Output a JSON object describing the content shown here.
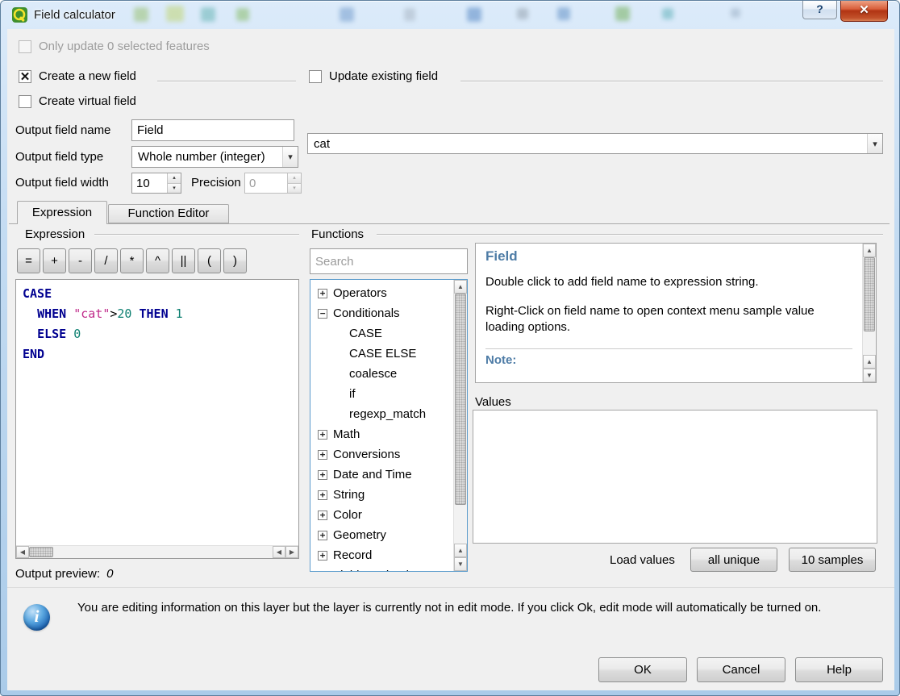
{
  "colors": {
    "keyword": "#000090",
    "field": "#c02a8a",
    "number": "#0c7f70",
    "help_heading": "#4e7ca6"
  },
  "icons": {
    "help": "?",
    "close": "✕",
    "check": "✕",
    "dropdown": "▾",
    "spin_up": "▴",
    "spin_down": "▾",
    "scroll_up": "▲",
    "scroll_down": "▼",
    "scroll_left": "◀",
    "scroll_right": "▶",
    "info": "i"
  },
  "window": {
    "title": "Field calculator"
  },
  "header": {
    "only_update_label": "Only update 0 selected features",
    "create_new_field_label": "Create a new field",
    "update_existing_label": "Update existing field",
    "create_virtual_label": "Create virtual field",
    "output_field_name_label": "Output field name",
    "output_field_name_value": "Field",
    "output_field_type_label": "Output field type",
    "output_field_type_value": "Whole number (integer)",
    "output_field_width_label": "Output field width",
    "output_field_width_value": "10",
    "precision_label": "Precision",
    "precision_value": "0",
    "existing_field_value": "cat"
  },
  "tabs": [
    {
      "label": "Expression"
    },
    {
      "label": "Function Editor"
    }
  ],
  "expression": {
    "group_label": "Expression",
    "operators": [
      "=",
      "+",
      "-",
      "/",
      "*",
      "^",
      "||",
      "(",
      ")"
    ],
    "code_lines": [
      [
        {
          "t": "CASE",
          "c": "kw"
        }
      ],
      [
        {
          "t": "  ",
          "c": "pl"
        },
        {
          "t": "WHEN",
          "c": "kw"
        },
        {
          "t": " ",
          "c": "pl"
        },
        {
          "t": "\"cat\"",
          "c": "str"
        },
        {
          "t": ">",
          "c": "pl"
        },
        {
          "t": "20",
          "c": "num"
        },
        {
          "t": " ",
          "c": "pl"
        },
        {
          "t": "THEN",
          "c": "kw"
        },
        {
          "t": " ",
          "c": "pl"
        },
        {
          "t": "1",
          "c": "num"
        }
      ],
      [
        {
          "t": "  ",
          "c": "pl"
        },
        {
          "t": "ELSE",
          "c": "kw"
        },
        {
          "t": " ",
          "c": "pl"
        },
        {
          "t": "0",
          "c": "num"
        }
      ],
      [
        {
          "t": "END",
          "c": "kw"
        }
      ]
    ],
    "output_preview_label": "Output preview:",
    "output_preview_value": "0"
  },
  "functions": {
    "group_label": "Functions",
    "search_placeholder": "Search",
    "tree": [
      {
        "label": "Operators",
        "expander": "+",
        "indent": 0
      },
      {
        "label": "Conditionals",
        "expander": "−",
        "indent": 0
      },
      {
        "label": "CASE",
        "indent": 1
      },
      {
        "label": "CASE ELSE",
        "indent": 1
      },
      {
        "label": "coalesce",
        "indent": 1
      },
      {
        "label": "if",
        "indent": 1
      },
      {
        "label": "regexp_match",
        "indent": 1
      },
      {
        "label": "Math",
        "expander": "+",
        "indent": 0
      },
      {
        "label": "Conversions",
        "expander": "+",
        "indent": 0
      },
      {
        "label": "Date and Time",
        "expander": "+",
        "indent": 0
      },
      {
        "label": "String",
        "expander": "+",
        "indent": 0
      },
      {
        "label": "Color",
        "expander": "+",
        "indent": 0
      },
      {
        "label": "Geometry",
        "expander": "+",
        "indent": 0
      },
      {
        "label": "Record",
        "expander": "+",
        "indent": 0
      },
      {
        "label": "Fields and Values",
        "expander": "+",
        "indent": 0
      }
    ]
  },
  "help": {
    "title": "Field",
    "para1": "Double click to add field name to expression string.",
    "para2": "Right-Click on field name to open context menu sample value loading options.",
    "note_label": "Note:"
  },
  "values": {
    "label": "Values",
    "load_values_label": "Load values",
    "all_unique_button": "all unique",
    "samples_button": "10 samples"
  },
  "footer": {
    "info_text": "You are editing information on this layer but the layer is currently not in edit mode. If you click Ok, edit mode will automatically be turned on.",
    "ok_button": "OK",
    "cancel_button": "Cancel",
    "help_button": "Help"
  }
}
